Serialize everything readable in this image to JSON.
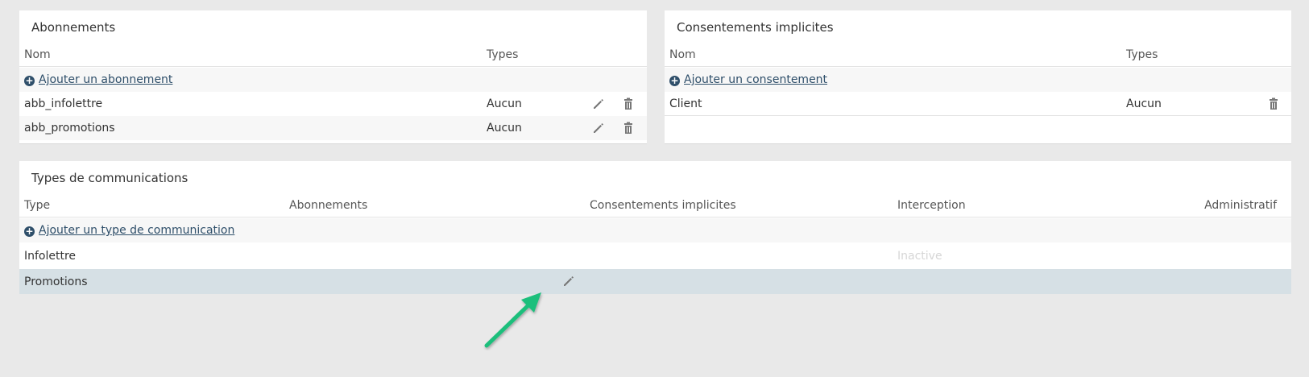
{
  "abonnements": {
    "title": "Abonnements",
    "col_name": "Nom",
    "col_types": "Types",
    "add_label": "Ajouter un abonnement",
    "rows": [
      {
        "name": "abb_infolettre",
        "types": "Aucun"
      },
      {
        "name": "abb_promotions",
        "types": "Aucun"
      }
    ]
  },
  "consentements": {
    "title": "Consentements implicites",
    "col_name": "Nom",
    "col_types": "Types",
    "add_label": "Ajouter un consentement",
    "rows": [
      {
        "name": "Client",
        "types": "Aucun"
      }
    ]
  },
  "communications": {
    "title": "Types de communications",
    "col_type": "Type",
    "col_abonnements": "Abonnements",
    "col_consentements": "Consentements implicites",
    "col_interception": "Interception",
    "col_administratif": "Administratif",
    "add_label": "Ajouter un type de communication",
    "rows": [
      {
        "type": "Infolettre",
        "interception": "Inactive"
      },
      {
        "type": "Promotions",
        "interception": ""
      }
    ]
  },
  "icons": {
    "edit": "pencil-icon",
    "delete": "trash-icon",
    "add": "plus-circle-icon",
    "annotation": "arrow-annotation"
  },
  "colors": {
    "link": "#2f4f6a",
    "highlight_row": "#d6e0e5",
    "arrow": "#1dbf7c",
    "icon": "#777777"
  }
}
